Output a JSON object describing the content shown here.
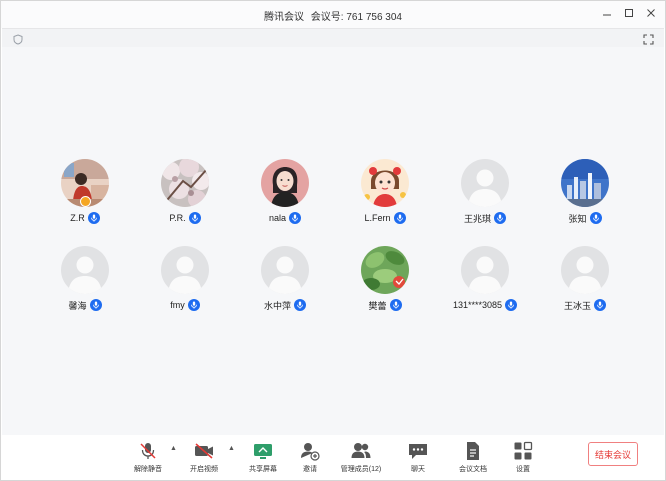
{
  "window": {
    "app_name": "腾讯会议",
    "meeting_id_label": "会议号:",
    "meeting_id": "761 756 304"
  },
  "participants": [
    {
      "name": "Z.R",
      "avatar": "photo-person-room",
      "host": true
    },
    {
      "name": "P.R.",
      "avatar": "photo-blossom"
    },
    {
      "name": "nala",
      "avatar": "illustration-girl"
    },
    {
      "name": "L.Fern",
      "avatar": "illustration-child"
    },
    {
      "name": "王兆琪",
      "avatar": "default"
    },
    {
      "name": "张知",
      "avatar": "photo-city-skyline"
    },
    {
      "name": "馨海",
      "avatar": "default"
    },
    {
      "name": "fmy",
      "avatar": "default"
    },
    {
      "name": "水中萍",
      "avatar": "default"
    },
    {
      "name": "樊蕾",
      "avatar": "photo-green-plant"
    },
    {
      "name": "131****3085",
      "avatar": "default"
    },
    {
      "name": "王冰玉",
      "avatar": "default"
    }
  ],
  "toolbar": {
    "unmute": "解除静音",
    "start_video": "开启视频",
    "share_screen": "共享屏幕",
    "invite": "邀请",
    "manage_members": "管理成员(12)",
    "chat": "聊天",
    "meeting_docs": "会议文档",
    "settings": "设置",
    "end_meeting": "结束会议"
  },
  "colors": {
    "accent_blue": "#1e6cf0",
    "danger_red": "#e53935",
    "share_green": "#2e9e6a"
  }
}
